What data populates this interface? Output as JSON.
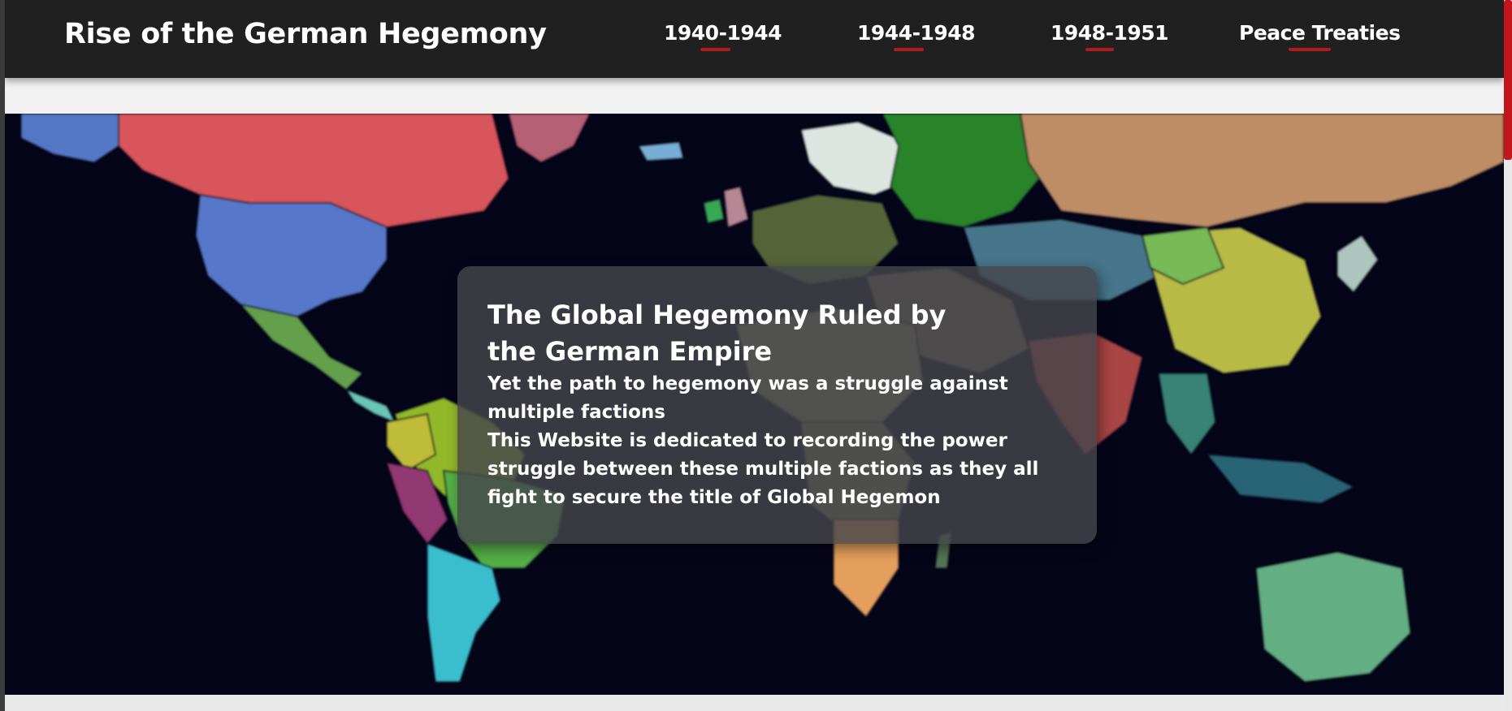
{
  "header": {
    "site_title": "Rise of the German Hegemony",
    "nav": [
      {
        "label": "1940-1944"
      },
      {
        "label": "1944-1948"
      },
      {
        "label": "1948-1951"
      },
      {
        "label": "Peace Treaties"
      }
    ]
  },
  "hero": {
    "background": "world-map-image",
    "heading": "The Global Hegemony Ruled by the German Empire",
    "paragraphs": [
      "Yet the path to hegemony was a struggle against multiple factions",
      "This Website is dedicated to recording the power struggle between these multiple factions as they all fight to secure the title of Global Hegemon"
    ]
  },
  "colors": {
    "header_bg": "#202020",
    "accent_red": "#b51a1a",
    "map_ocean": "#05051a",
    "card_bg": "#46464c"
  }
}
